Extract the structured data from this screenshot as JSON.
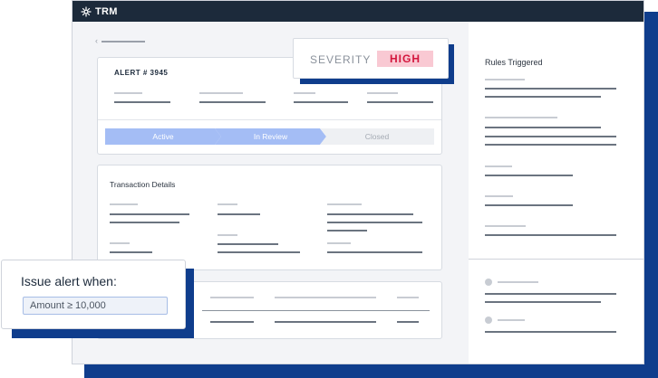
{
  "app": {
    "brand": "TRM"
  },
  "alert": {
    "title": "ALERT # 3945"
  },
  "status_steps": [
    {
      "label": "Active",
      "state": "complete"
    },
    {
      "label": "In Review",
      "state": "current"
    },
    {
      "label": "Closed",
      "state": "pending"
    }
  ],
  "transaction": {
    "title": "Transaction Details"
  },
  "severity": {
    "label": "SEVERITY",
    "value": "HIGH"
  },
  "rules": {
    "title": "Rules Triggered"
  },
  "issue": {
    "title": "Issue alert when:",
    "input_value": "Amount ≥ 10,000"
  },
  "colors": {
    "titlebar": "#1c2a3b",
    "accent_blue": "#0f3d8c",
    "step_active": "#a4bdf5",
    "severity_bg": "#f9c9d3",
    "severity_text": "#d3163d"
  }
}
